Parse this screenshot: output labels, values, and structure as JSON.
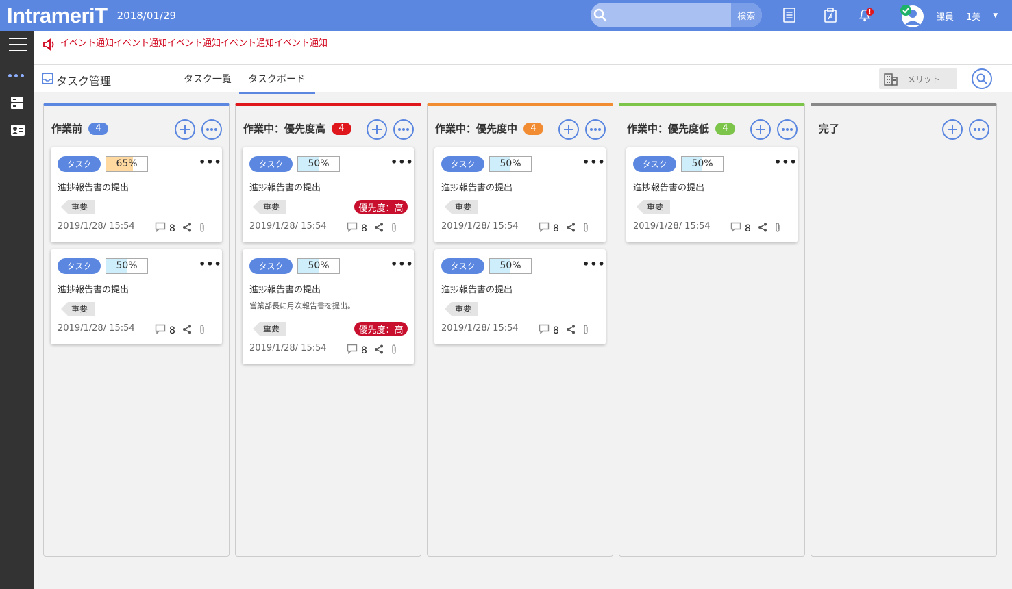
{
  "header": {
    "logo": "IntrameriT",
    "date": "2018/01/29",
    "search_button": "検索",
    "search_placeholder": "",
    "user_role": "課員",
    "user_name": "1美",
    "bell_alert": "!"
  },
  "notice": {
    "text": "イベント通知イベント通知イベント通知イベント通知イベント通知"
  },
  "subheader": {
    "title": "タスク管理",
    "tabs": [
      {
        "label": "タスク一覧",
        "active": false
      },
      {
        "label": "タスクボード",
        "active": true
      }
    ],
    "merit_label": "メリット"
  },
  "columns": [
    {
      "title": "作業前",
      "count": "4",
      "color": "#5b87e0",
      "cards": [
        {
          "tag": "タスク",
          "percent": "65%",
          "progress": 0.65,
          "progress_color": "#ffd9a0",
          "title": "進捗報告書の提出",
          "label": "重要",
          "datetime": "2019/1/28/ 15:54",
          "comments": "8"
        },
        {
          "tag": "タスク",
          "percent": "50%",
          "progress": 0.5,
          "progress_color": "#cdeefa",
          "title": "進捗報告書の提出",
          "label": "重要",
          "datetime": "2019/1/28/ 15:54",
          "comments": "8"
        }
      ]
    },
    {
      "title": "作業中：優先度高",
      "count": "4",
      "color": "#e0161d",
      "cards": [
        {
          "tag": "タスク",
          "percent": "50%",
          "progress": 0.5,
          "progress_color": "#cdeefa",
          "title": "進捗報告書の提出",
          "label": "重要",
          "priority": "優先度：高",
          "datetime": "2019/1/28/ 15:54",
          "comments": "8"
        },
        {
          "tag": "タスク",
          "percent": "50%",
          "progress": 0.5,
          "progress_color": "#cdeefa",
          "title": "進捗報告書の提出",
          "description": "営業部長に月次報告書を提出。",
          "label": "重要",
          "priority": "優先度：高",
          "datetime": "2019/1/28/ 15:54",
          "comments": "8"
        }
      ]
    },
    {
      "title": "作業中：優先度中",
      "count": "4",
      "color": "#f28c33",
      "cards": [
        {
          "tag": "タスク",
          "percent": "50%",
          "progress": 0.5,
          "progress_color": "#cdeefa",
          "title": "進捗報告書の提出",
          "label": "重要",
          "datetime": "2019/1/28/ 15:54",
          "comments": "8"
        },
        {
          "tag": "タスク",
          "percent": "50%",
          "progress": 0.5,
          "progress_color": "#cdeefa",
          "title": "進捗報告書の提出",
          "label": "重要",
          "datetime": "2019/1/28/ 15:54",
          "comments": "8"
        }
      ]
    },
    {
      "title": "作業中：優先度低",
      "count": "4",
      "color": "#7cc44a",
      "cards": [
        {
          "tag": "タスク",
          "percent": "50%",
          "progress": 0.5,
          "progress_color": "#cdeefa",
          "title": "進捗報告書の提出",
          "label": "重要",
          "datetime": "2019/1/28/ 15:54",
          "comments": "8"
        }
      ]
    },
    {
      "title": "完了",
      "count": "",
      "color": "#888888",
      "cards": []
    }
  ]
}
